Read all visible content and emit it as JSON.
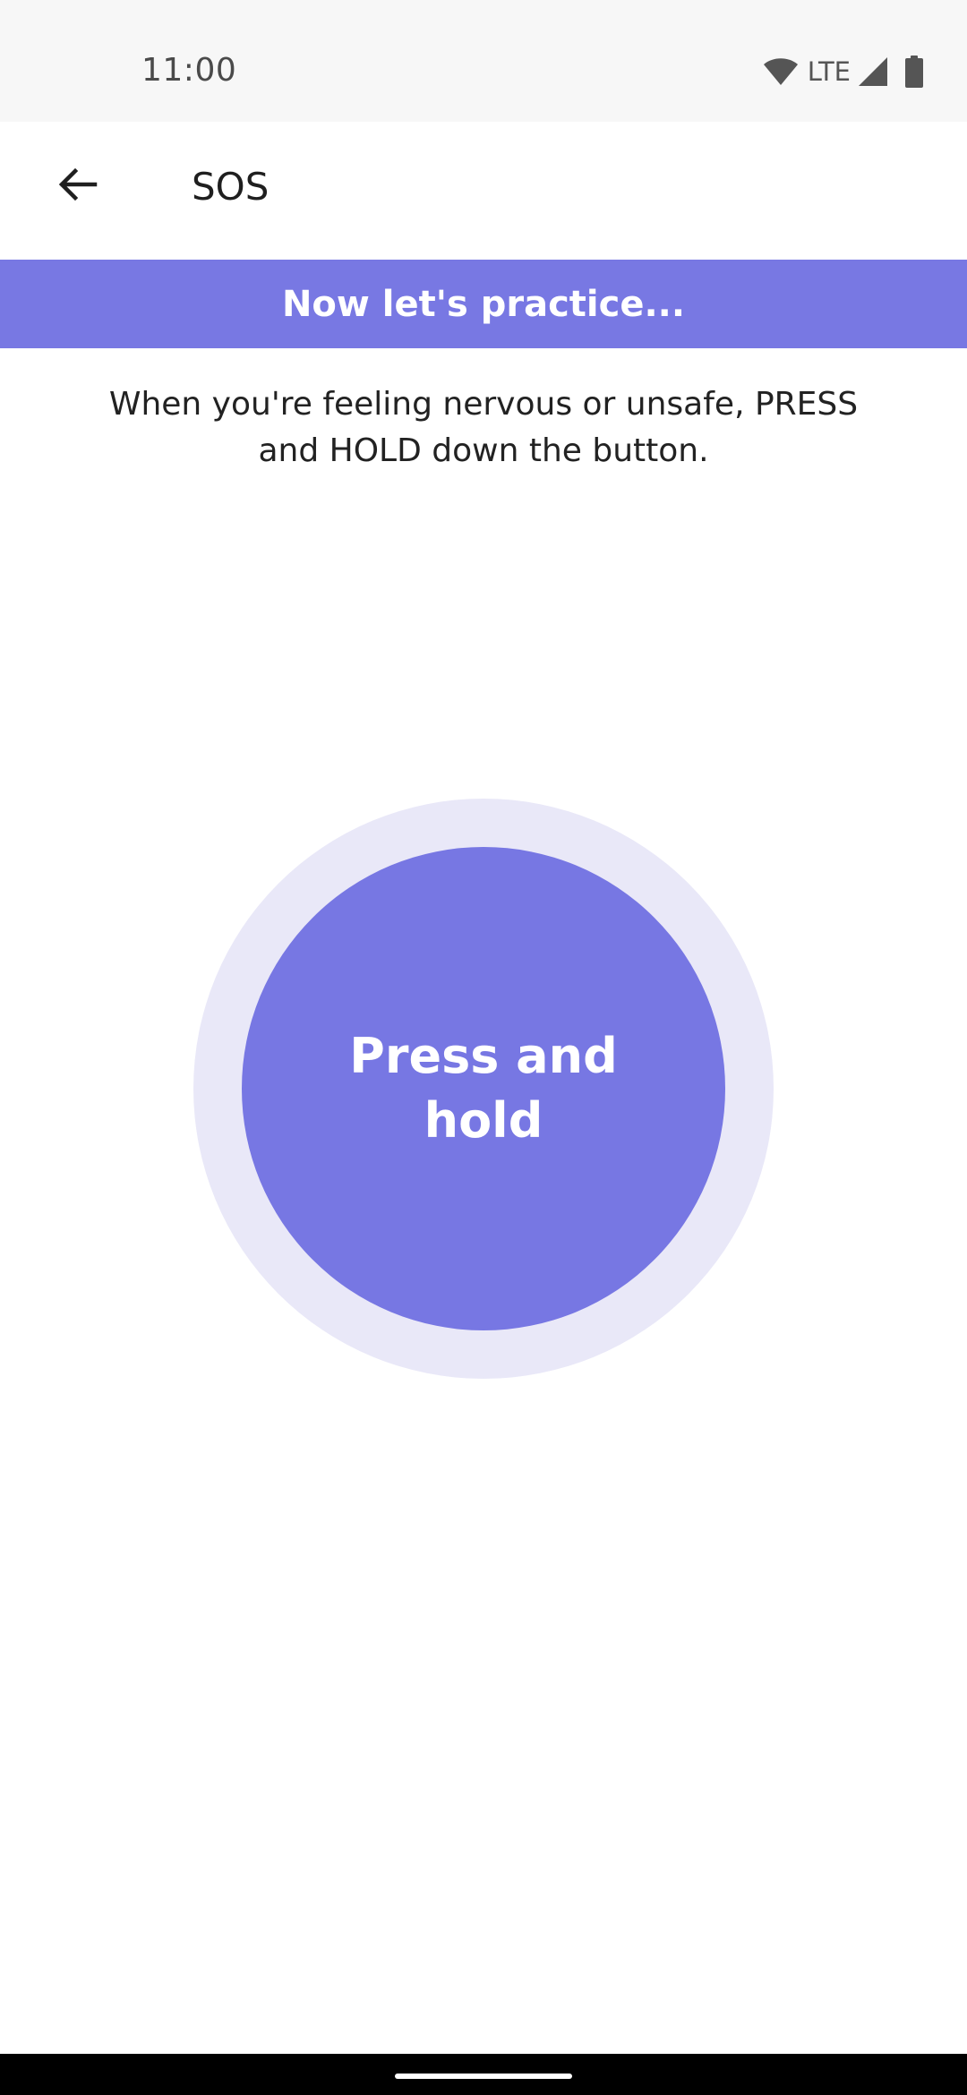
{
  "status_bar": {
    "time": "11:00",
    "network": "LTE",
    "icons": [
      "wifi-icon",
      "signal-icon",
      "battery-icon"
    ]
  },
  "app_bar": {
    "back_icon": "arrow-left-icon",
    "title": "SOS"
  },
  "banner": {
    "text": "Now let's practice..."
  },
  "instruction": {
    "line1": "When you're feeling nervous or unsafe, PRESS",
    "line2": "and HOLD down the button."
  },
  "sos_button": {
    "label_line1": "Press and",
    "label_line2": "hold"
  },
  "colors": {
    "accent": "#7878e3",
    "ring": "#e9e8f8",
    "status_bar_bg": "#f7f7f7"
  }
}
